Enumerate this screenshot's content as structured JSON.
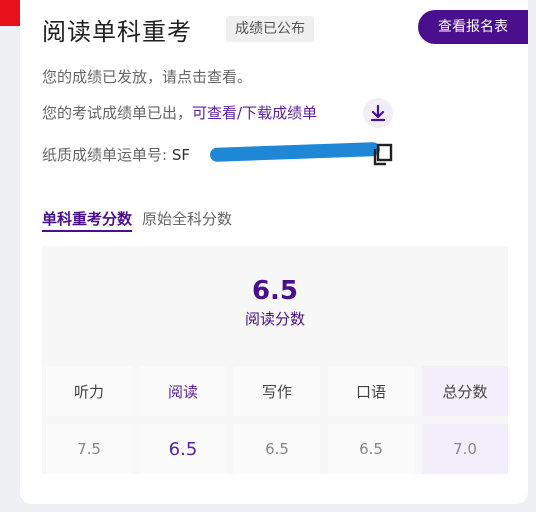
{
  "header": {
    "title": "阅读单科重考",
    "status_badge": "成绩已公布",
    "view_button": "查看报名表"
  },
  "info": {
    "line1": "您的成绩已发放，请点击查看。",
    "line2_prefix": "您的考试成绩单已出，",
    "line2_link_view": "可查看",
    "line2_sep": "/",
    "line2_link_download": "下载成绩单",
    "line3_label": "纸质成绩单运单号: ",
    "line3_partial": "SF"
  },
  "tabs": {
    "active": "单科重考分数",
    "other": "原始全科分数"
  },
  "score": {
    "value": "6.5",
    "label": "阅读分数"
  },
  "table": {
    "headers": [
      "听力",
      "阅读",
      "写作",
      "口语",
      "总分数"
    ],
    "values": [
      "7.5",
      "6.5",
      "6.5",
      "6.5",
      "7.0"
    ]
  },
  "colors": {
    "brand": "#4a0f8c",
    "accent_red": "#e8111b"
  }
}
